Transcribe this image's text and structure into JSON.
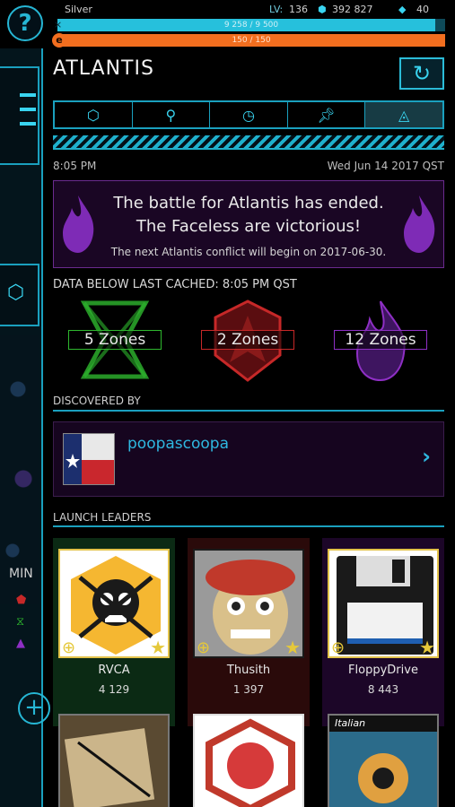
{
  "status": {
    "faction_rank": "Silver",
    "level_label": "LV:",
    "level": "136",
    "currency": "392 827",
    "cubes": "40",
    "xp_text": "9 258 / 9 500",
    "xp_fraction": 0.974,
    "energy_text": "150 / 150",
    "energy_fraction": 1.0,
    "xp_color": "#26c0dc",
    "energy_color": "#f26e1f"
  },
  "rail": {
    "label": "MIN"
  },
  "header": {
    "title": "ATLANTIS",
    "refresh_icon": "refresh-icon"
  },
  "tabs": [
    {
      "icon": "hexagon-icon"
    },
    {
      "icon": "search-icon"
    },
    {
      "icon": "clock-icon"
    },
    {
      "icon": "pin-icon"
    },
    {
      "icon": "triangle-icon",
      "active": true
    }
  ],
  "times": {
    "local": "8:05 PM",
    "date": "Wed Jun 14 2017 QST"
  },
  "banner": {
    "line1": "The battle for Atlantis has ended.",
    "line2": "The Faceless are victorious!",
    "line3": "The next Atlantis conflict will begin on 2017-06-30."
  },
  "cached_text": "DATA BELOW LAST CACHED: 8:05 PM QST",
  "zones": [
    {
      "label": "5 Zones",
      "color": "#2eb82e"
    },
    {
      "label": "2 Zones",
      "color": "#c62828"
    },
    {
      "label": "12 Zones",
      "color": "#8e2fc4"
    }
  ],
  "discovered": {
    "heading": "DISCOVERED BY",
    "agent": "poopascoopa"
  },
  "leaders": {
    "heading": "LAUNCH LEADERS",
    "items": [
      {
        "name": "RVCA",
        "ap": "4 129"
      },
      {
        "name": "Thusith",
        "ap": "1 397"
      },
      {
        "name": "FloppyDrive",
        "ap": "8 443"
      }
    ],
    "next_tile_text": "Italian"
  }
}
